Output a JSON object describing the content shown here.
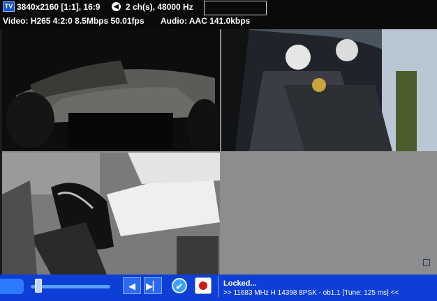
{
  "info": {
    "tv_badge": "TV",
    "resolution": "3840x2160 [1:1], 16:9",
    "audio_channels": "2 ch(s), 48000 Hz",
    "video_line": "Video: H265  4:2:0  8.5Mbps  50.01fps",
    "audio_line": "Audio: AAC  141.0kbps"
  },
  "video": {
    "q1_desc": "in-car camera: road through windshield",
    "q2_desc": "in-car camera: driver and co-driver",
    "q3_desc": "in-car camera: driver feet on pedals"
  },
  "controls": {
    "seek_position": 0.05,
    "rewind_icon": "rewind-icon",
    "forward_icon": "forward-icon",
    "check_icon": "check-icon",
    "record_icon": "record-icon",
    "status": "Locked...",
    "detail": ">> 11683 MHz H 14398 8PSK - ob1.1 [Tune: 125 ms] <<"
  }
}
